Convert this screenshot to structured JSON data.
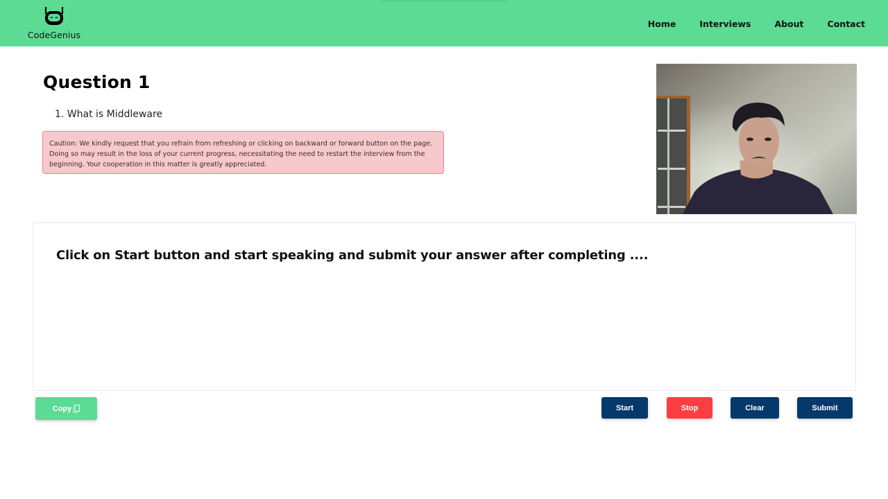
{
  "navbar": {
    "brand": {
      "name": "CodeGenius",
      "logo_icon": "robot-icon"
    },
    "links": [
      {
        "label": "Home"
      },
      {
        "label": "Interviews"
      },
      {
        "label": "About"
      },
      {
        "label": "Contact"
      }
    ],
    "background_color": "#5cdb95"
  },
  "question": {
    "title": "Question 1",
    "items": [
      "1. What is Middleware"
    ]
  },
  "caution": {
    "text": "Caution: We kindly request that you refrain from refreshing or clicking on backward or forward button on the page. Doing so may result in the loss of your current progress, necessitating the need to restart the interview from the beginning. Your cooperation in this matter is greatly appreciated."
  },
  "webcam": {
    "label": "webcam-feed"
  },
  "transcript": {
    "text": "Click on Start button and start speaking and submit your answer after completing ...."
  },
  "buttons": {
    "copy": {
      "label": "Copy",
      "icon": "copy-icon",
      "color": "#5cdb95"
    },
    "start": {
      "label": "Start",
      "color": "#05386b"
    },
    "stop": {
      "label": "Stop",
      "color": "#fd3d44"
    },
    "clear": {
      "label": "Clear",
      "color": "#05386b"
    },
    "submit": {
      "label": "Submit",
      "color": "#05386b"
    }
  }
}
